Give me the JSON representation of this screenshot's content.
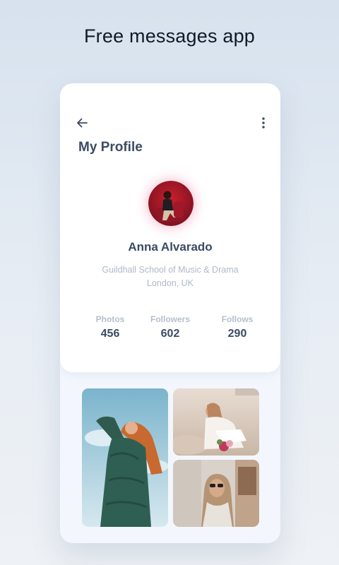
{
  "headline": "Free messages app",
  "profile": {
    "title": "My Profile",
    "name": "Anna Alvarado",
    "school": "Guildhall School of Music & Drama",
    "location": "London,  UK"
  },
  "stats": [
    {
      "label": "Photos",
      "value": "456"
    },
    {
      "label": "Followers",
      "value": "602"
    },
    {
      "label": "Follows",
      "value": "290"
    }
  ],
  "icons": {
    "back": "arrow-left-icon",
    "more": "more-vertical-icon"
  },
  "colors": {
    "accent_glow": "#ec4878",
    "title_text": "#3b4b64",
    "muted_text": "#aeb9c9"
  }
}
